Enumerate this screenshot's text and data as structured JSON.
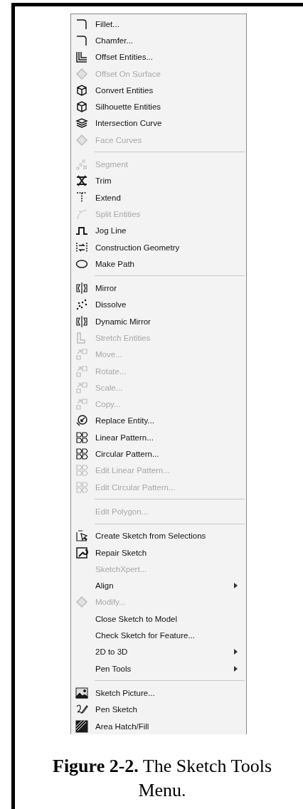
{
  "menu": {
    "sections": [
      {
        "items": [
          {
            "label": "Fillet...",
            "disabled": false,
            "submenu": false
          },
          {
            "label": "Chamfer...",
            "disabled": false,
            "submenu": false
          },
          {
            "label": "Offset Entities...",
            "disabled": false,
            "submenu": false
          },
          {
            "label": "Offset On Surface",
            "disabled": true,
            "submenu": false
          },
          {
            "label": "Convert Entities",
            "disabled": false,
            "submenu": false
          },
          {
            "label": "Silhouette Entities",
            "disabled": false,
            "submenu": false
          },
          {
            "label": "Intersection Curve",
            "disabled": false,
            "submenu": false
          },
          {
            "label": "Face Curves",
            "disabled": true,
            "submenu": false
          }
        ]
      },
      {
        "items": [
          {
            "label": "Segment",
            "disabled": true,
            "submenu": false
          },
          {
            "label": "Trim",
            "disabled": false,
            "submenu": false
          },
          {
            "label": "Extend",
            "disabled": false,
            "submenu": false
          },
          {
            "label": "Split Entities",
            "disabled": true,
            "submenu": false
          },
          {
            "label": "Jog Line",
            "disabled": false,
            "submenu": false
          },
          {
            "label": "Construction Geometry",
            "disabled": false,
            "submenu": false
          },
          {
            "label": "Make Path",
            "disabled": false,
            "submenu": false
          }
        ]
      },
      {
        "items": [
          {
            "label": "Mirror",
            "disabled": false,
            "submenu": false
          },
          {
            "label": "Dissolve",
            "disabled": false,
            "submenu": false
          },
          {
            "label": "Dynamic Mirror",
            "disabled": false,
            "submenu": false
          },
          {
            "label": "Stretch Entities",
            "disabled": true,
            "submenu": false
          },
          {
            "label": "Move...",
            "disabled": true,
            "submenu": false
          },
          {
            "label": "Rotate...",
            "disabled": true,
            "submenu": false
          },
          {
            "label": "Scale...",
            "disabled": true,
            "submenu": false
          },
          {
            "label": "Copy...",
            "disabled": true,
            "submenu": false
          },
          {
            "label": "Replace Entity...",
            "disabled": false,
            "submenu": false
          },
          {
            "label": "Linear Pattern...",
            "disabled": false,
            "submenu": false
          },
          {
            "label": "Circular Pattern...",
            "disabled": false,
            "submenu": false
          },
          {
            "label": "Edit Linear Pattern...",
            "disabled": true,
            "submenu": false
          },
          {
            "label": "Edit Circular Pattern...",
            "disabled": true,
            "submenu": false
          }
        ]
      },
      {
        "items": [
          {
            "label": "Edit Polygon...",
            "disabled": true,
            "submenu": false
          }
        ]
      },
      {
        "items": [
          {
            "label": "Create Sketch from Selections",
            "disabled": false,
            "submenu": false
          },
          {
            "label": "Repair Sketch",
            "disabled": false,
            "submenu": false
          },
          {
            "label": "SketchXpert...",
            "disabled": true,
            "submenu": false
          },
          {
            "label": "Align",
            "disabled": false,
            "submenu": true
          },
          {
            "label": "Modify...",
            "disabled": true,
            "submenu": false
          },
          {
            "label": "Close Sketch to Model",
            "disabled": false,
            "submenu": false
          },
          {
            "label": "Check Sketch for Feature...",
            "disabled": false,
            "submenu": false
          },
          {
            "label": "2D to 3D",
            "disabled": false,
            "submenu": true
          },
          {
            "label": "Pen Tools",
            "disabled": false,
            "submenu": true
          }
        ]
      },
      {
        "items": [
          {
            "label": "Sketch Picture...",
            "disabled": false,
            "submenu": false
          },
          {
            "label": "Pen Sketch",
            "disabled": false,
            "submenu": false
          },
          {
            "label": "Area Hatch/Fill",
            "disabled": false,
            "submenu": false
          }
        ]
      }
    ]
  },
  "caption": "**Figure 2-2.** The Sketch Tools Menu."
}
